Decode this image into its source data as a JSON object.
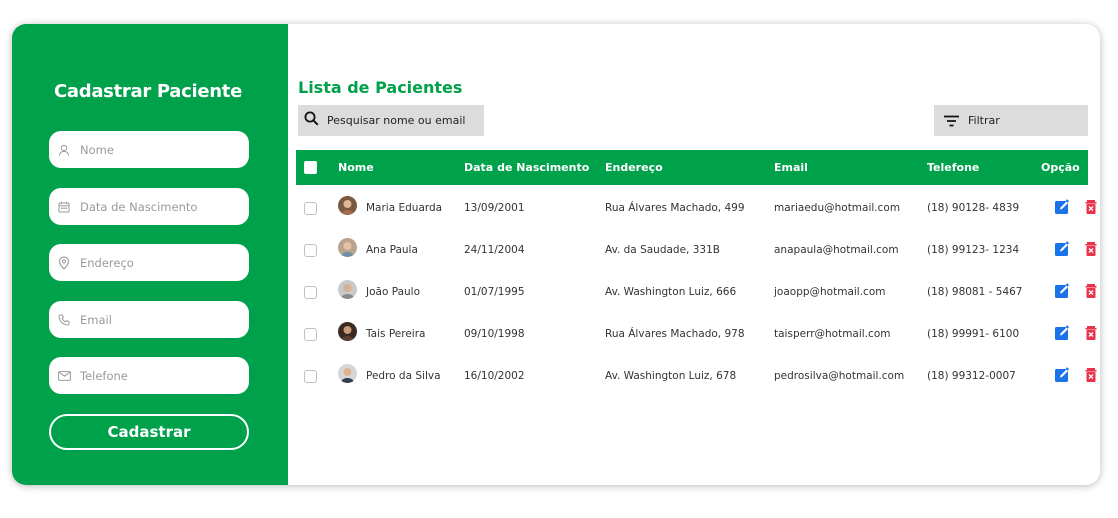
{
  "form": {
    "title": "Cadastrar Paciente",
    "fields": [
      {
        "placeholder": "Nome",
        "icon": "user-icon"
      },
      {
        "placeholder": "Data de Nascimento",
        "icon": "calendar-icon"
      },
      {
        "placeholder": "Endereço",
        "icon": "location-pin-icon"
      },
      {
        "placeholder": "Email",
        "icon": "phone-icon"
      },
      {
        "placeholder": "Telefone",
        "icon": "mail-icon"
      }
    ],
    "submit_label": "Cadastrar"
  },
  "list": {
    "title": "Lista de Pacientes",
    "search_placeholder": "Pesquisar nome ou email",
    "filter_label": "Filtrar",
    "columns": {
      "name": "Nome",
      "birth": "Data de Nascimento",
      "address": "Endereço",
      "email": "Email",
      "phone": "Telefone",
      "options": "Opção"
    },
    "rows": [
      {
        "name": "Maria Eduarda",
        "birth": "13/09/2001",
        "address": "Rua Álvares Machado, 499",
        "email": "mariaedu@hotmail.com",
        "phone": "(18) 90128- 4839"
      },
      {
        "name": "Ana Paula",
        "birth": "24/11/2004",
        "address": "Av. da Saudade, 331B",
        "email": "anapaula@hotmail.com",
        "phone": "(18) 99123- 1234"
      },
      {
        "name": "João Paulo",
        "birth": "01/07/1995",
        "address": "Av. Washington Luiz, 666",
        "email": "joaopp@hotmail.com",
        "phone": "(18) 98081 - 5467"
      },
      {
        "name": "Tais Pereira",
        "birth": "09/10/1998",
        "address": "Rua Álvares Machado, 978",
        "email": "taisperr@hotmail.com",
        "phone": "(18) 99991- 6100"
      },
      {
        "name": "Pedro da Silva",
        "birth": "16/10/2002",
        "address": "Av. Washington Luiz, 678",
        "email": "pedrosilva@hotmail.com",
        "phone": "(18) 99312-0007"
      }
    ]
  },
  "colors": {
    "brand_green": "#00a14b",
    "edit_blue": "#1a73e8",
    "delete_red": "#e8334a"
  }
}
